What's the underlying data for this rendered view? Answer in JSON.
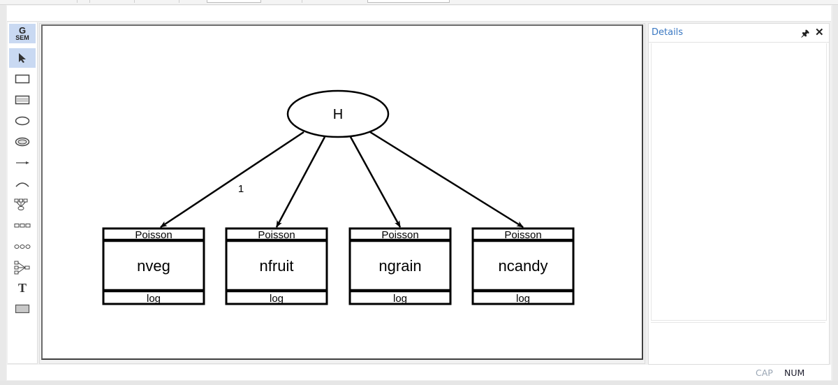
{
  "toolbar": {
    "tools": [
      {
        "name": "gsem-logo",
        "label_top": "G",
        "label_bottom": "SEM",
        "active": true
      },
      {
        "name": "select-tool",
        "icon": "pointer-arrow-icon",
        "active": true
      },
      {
        "name": "observed-variable-tool",
        "icon": "rectangle-icon"
      },
      {
        "name": "generalized-response-tool",
        "icon": "banded-rectangle-icon"
      },
      {
        "name": "latent-variable-tool",
        "icon": "ellipse-icon"
      },
      {
        "name": "multilevel-latent-tool",
        "icon": "double-ellipse-icon"
      },
      {
        "name": "path-tool",
        "icon": "arrow-right-icon"
      },
      {
        "name": "covariance-tool",
        "icon": "curved-arc-icon"
      },
      {
        "name": "measurement-component-tool",
        "icon": "measurement-tree-icon"
      },
      {
        "name": "observed-set-tool",
        "icon": "three-rectangles-icon"
      },
      {
        "name": "latent-set-tool",
        "icon": "three-ellipses-icon"
      },
      {
        "name": "regression-component-tool",
        "icon": "regression-fan-icon"
      },
      {
        "name": "text-tool",
        "icon": "text-T-icon",
        "label": "T"
      },
      {
        "name": "area-tool",
        "icon": "filled-rectangle-icon"
      }
    ]
  },
  "diagram": {
    "latent": {
      "label": "H"
    },
    "path_constraint": "1",
    "observed": [
      {
        "family": "Poisson",
        "name": "nveg",
        "link": "log"
      },
      {
        "family": "Poisson",
        "name": "nfruit",
        "link": "log"
      },
      {
        "family": "Poisson",
        "name": "ngrain",
        "link": "log"
      },
      {
        "family": "Poisson",
        "name": "ncandy",
        "link": "log"
      }
    ]
  },
  "details": {
    "title": "Details",
    "pin_icon": "pin-icon",
    "close_icon": "close-icon"
  },
  "status": {
    "cap": "CAP",
    "num": "NUM"
  }
}
